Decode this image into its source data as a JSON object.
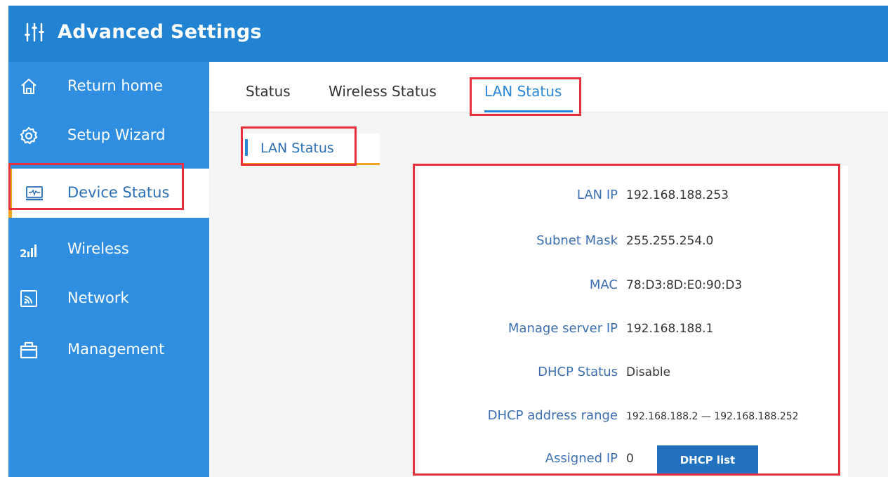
{
  "header": {
    "title": "Advanced Settings",
    "icon": "sliders-icon",
    "color": "#2283d3"
  },
  "sidebar": {
    "items": [
      {
        "label": "Return home",
        "icon": "home-icon"
      },
      {
        "label": "Setup Wizard",
        "icon": "gear-icon"
      },
      {
        "label": "Device Status",
        "icon": "monitor-pulse-icon",
        "active": true
      },
      {
        "label": "Wireless",
        "icon": "signal-bars-icon"
      },
      {
        "label": "Network",
        "icon": "rss-icon"
      },
      {
        "label": "Management",
        "icon": "toolbox-icon"
      }
    ]
  },
  "tabs": [
    {
      "label": "Status"
    },
    {
      "label": "Wireless Status"
    },
    {
      "label": "LAN Status",
      "active": true
    }
  ],
  "subtab": {
    "label": "LAN Status"
  },
  "lan": {
    "lan_ip": {
      "label": "LAN IP",
      "value": "192.168.188.253"
    },
    "subnet_mask": {
      "label": "Subnet Mask",
      "value": "255.255.254.0"
    },
    "mac": {
      "label": "MAC",
      "value": "78:D3:8D:E0:90:D3"
    },
    "manage_server_ip": {
      "label": "Manage server IP",
      "value": "192.168.188.1"
    },
    "dhcp_status": {
      "label": "DHCP Status",
      "value": "Disable"
    },
    "dhcp_range": {
      "label": "DHCP address range",
      "value": "192.168.188.2 — 192.168.188.252"
    },
    "assigned_ip": {
      "label": "Assigned IP",
      "value": "0"
    }
  },
  "buttons": {
    "dhcp_list": "DHCP list"
  },
  "colors": {
    "accent": "#2a86d8",
    "active_marker": "#f3a41f",
    "highlight_box": "#e4313b"
  }
}
